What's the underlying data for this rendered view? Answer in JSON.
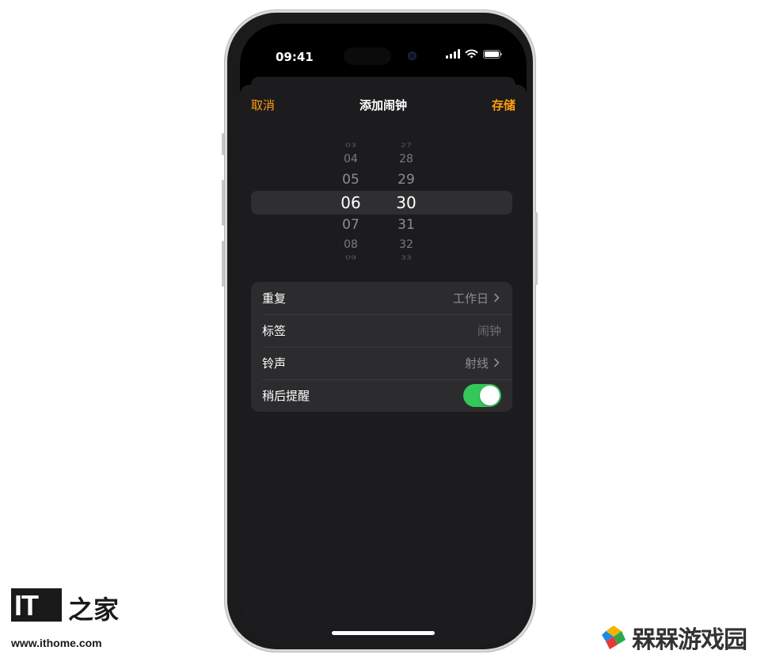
{
  "status_bar": {
    "time": "09:41"
  },
  "nav": {
    "cancel": "取消",
    "title": "添加闹钟",
    "save": "存储"
  },
  "picker": {
    "hours": [
      "03",
      "04",
      "05",
      "06",
      "07",
      "08",
      "09"
    ],
    "minutes": [
      "27",
      "28",
      "29",
      "30",
      "31",
      "32",
      "33"
    ],
    "selected_hour": "06",
    "selected_minute": "30"
  },
  "settings": {
    "repeat": {
      "label": "重复",
      "value": "工作日"
    },
    "label": {
      "label": "标签",
      "placeholder": "闹钟"
    },
    "sound": {
      "label": "铃声",
      "value": "射线"
    },
    "snooze": {
      "label": "稍后提醒",
      "on": true
    }
  },
  "watermarks": {
    "ithome_logo": "IT",
    "ithome_chars": "之家",
    "ithome_url": "www.ithome.com",
    "game_site": "槑槑游戏园"
  },
  "colors": {
    "accent": "#ff9f0a",
    "toggle_on": "#34c759",
    "sheet": "#1c1c1e",
    "cell": "#2c2c2e"
  },
  "icons": {
    "chevron": "chevron-right-icon",
    "signal": "cellular-signal-icon",
    "wifi": "wifi-icon",
    "battery": "battery-icon"
  }
}
